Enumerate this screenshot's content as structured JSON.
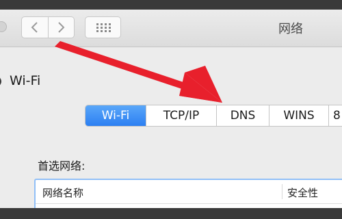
{
  "window": {
    "title": "网络"
  },
  "toolbar": {
    "back": "back",
    "forward": "forward",
    "show_all": "show-all"
  },
  "interface": {
    "name": "Wi-Fi"
  },
  "tabs": [
    {
      "label": "Wi-Fi",
      "active": true
    },
    {
      "label": "TCP/IP",
      "active": false
    },
    {
      "label": "DNS",
      "active": false
    },
    {
      "label": "WINS",
      "active": false
    },
    {
      "label": "8",
      "active": false
    }
  ],
  "preferred_networks": {
    "label": "首选网络:",
    "columns": {
      "name": "网络名称",
      "security": "安全性"
    }
  },
  "colors": {
    "accent": "#2c7ff2",
    "annotation_arrow": "#e8202c",
    "focus_ring": "#90bff7"
  },
  "icons": {
    "back": "chevron-left-icon",
    "forward": "chevron-right-icon",
    "grid": "grid-icon",
    "wifi": "wifi-icon",
    "arrow": "annotation-arrow"
  }
}
